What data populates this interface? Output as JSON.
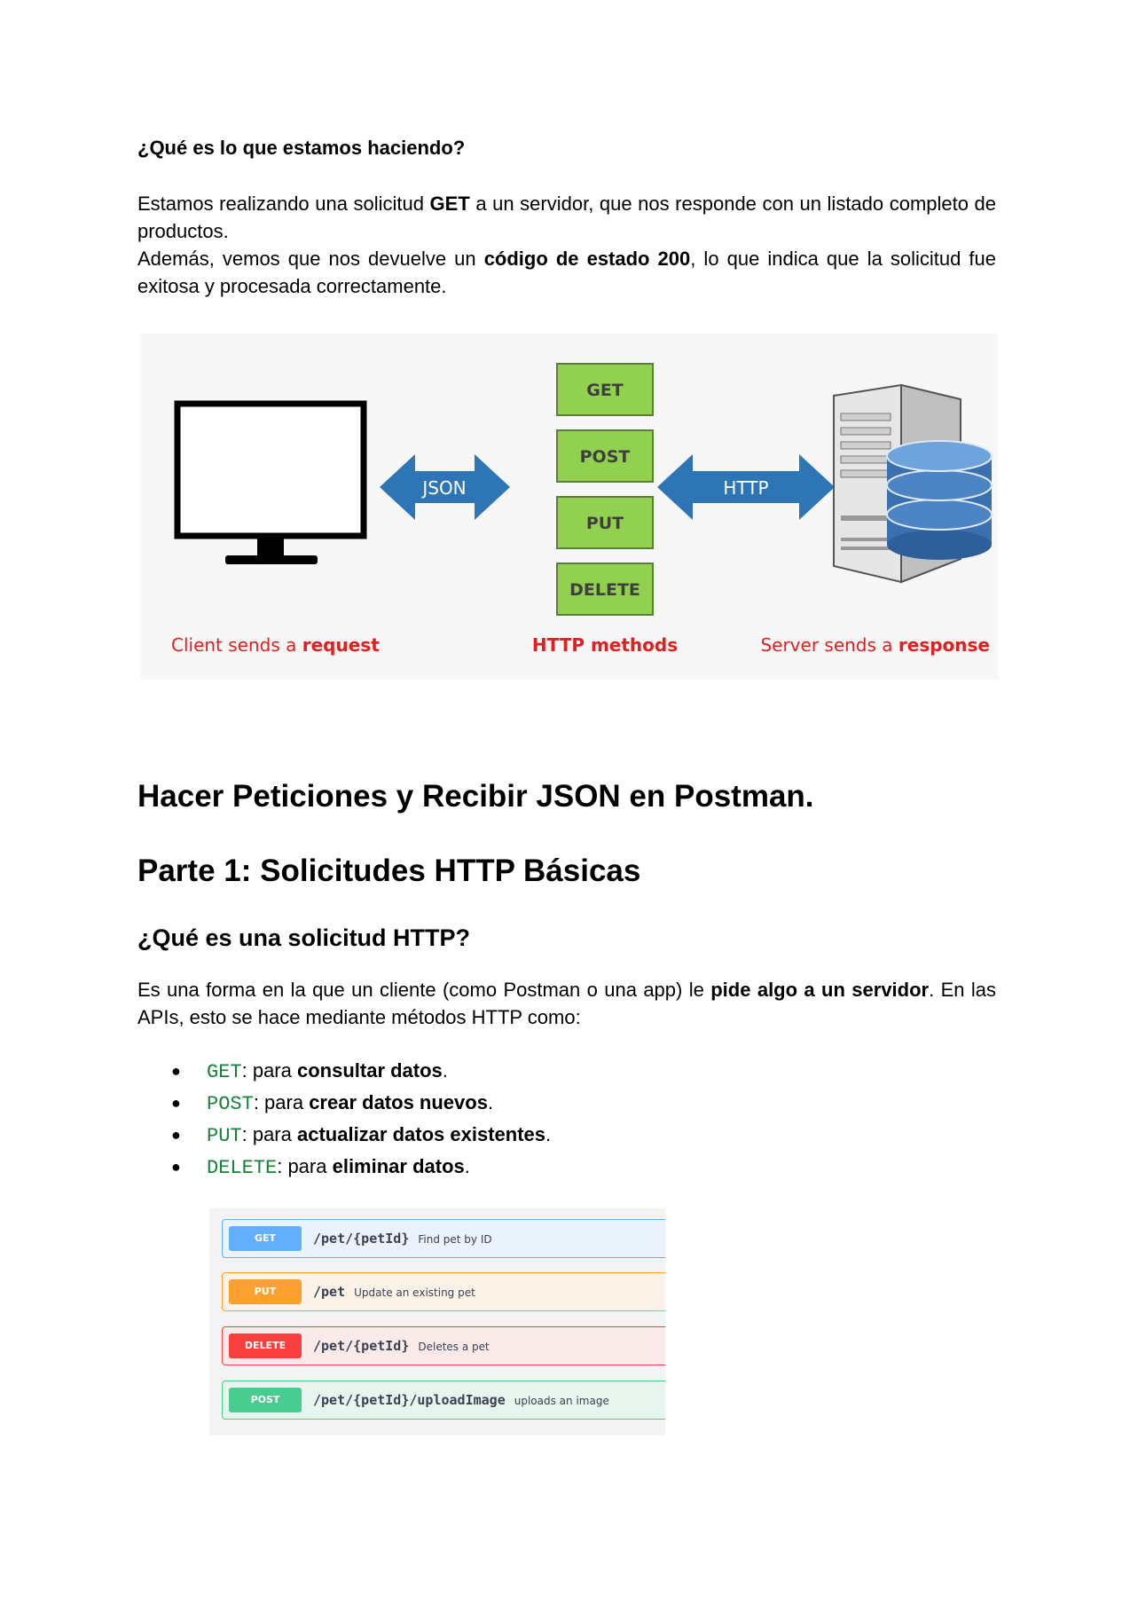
{
  "section1": {
    "heading": "¿Qué es lo que estamos haciendo?",
    "para1": {
      "t1": "Estamos realizando una solicitud ",
      "b1": "GET",
      "t2": " a un servidor, que nos responde con un listado completo de productos."
    },
    "para2": {
      "t1": "Además, vemos que nos devuelve un ",
      "b1": "código de estado 200",
      "t2": ", lo que indica que la solicitud fue exitosa y procesada correctamente."
    }
  },
  "diagram": {
    "methods": [
      "GET",
      "POST",
      "PUT",
      "DELETE"
    ],
    "left_arrow": "JSON",
    "right_arrow": "HTTP",
    "caption_client": {
      "text": "Client sends a ",
      "bold": "request"
    },
    "caption_methods": "HTTP methods",
    "caption_server": {
      "text": "Server sends a ",
      "bold": "response"
    },
    "colors": {
      "method_box": "#92d050",
      "arrow": "#2e75b6",
      "caption": "#e02020"
    }
  },
  "section2": {
    "title": "Hacer Peticiones y Recibir JSON en Postman.",
    "part_title": "Parte 1: Solicitudes HTTP Básicas",
    "subtitle": "¿Qué es una solicitud HTTP?",
    "para": {
      "t1": "Es una forma en la que un cliente (como Postman o una app) le ",
      "b1": "pide algo a un servidor",
      "t2": ". En las APIs, esto se hace mediante métodos HTTP como:"
    },
    "bullets": [
      {
        "code": "GET",
        "mid": ": para ",
        "bold": "consultar datos",
        "end": "."
      },
      {
        "code": "POST",
        "mid": ": para ",
        "bold": "crear datos nuevos",
        "end": "."
      },
      {
        "code": "PUT",
        "mid": ": para ",
        "bold": "actualizar datos existentes",
        "end": "."
      },
      {
        "code": "DELETE",
        "mid": ": para ",
        "bold": "eliminar datos",
        "end": "."
      }
    ]
  },
  "swagger": [
    {
      "method": "GET",
      "path": "/pet/{petId}",
      "desc": "Find pet by ID"
    },
    {
      "method": "PUT",
      "path": "/pet",
      "desc": "Update an existing pet"
    },
    {
      "method": "DELETE",
      "path": "/pet/{petId}",
      "desc": "Deletes a pet"
    },
    {
      "method": "POST",
      "path": "/pet/{petId}/uploadImage",
      "desc": "uploads an image"
    }
  ]
}
